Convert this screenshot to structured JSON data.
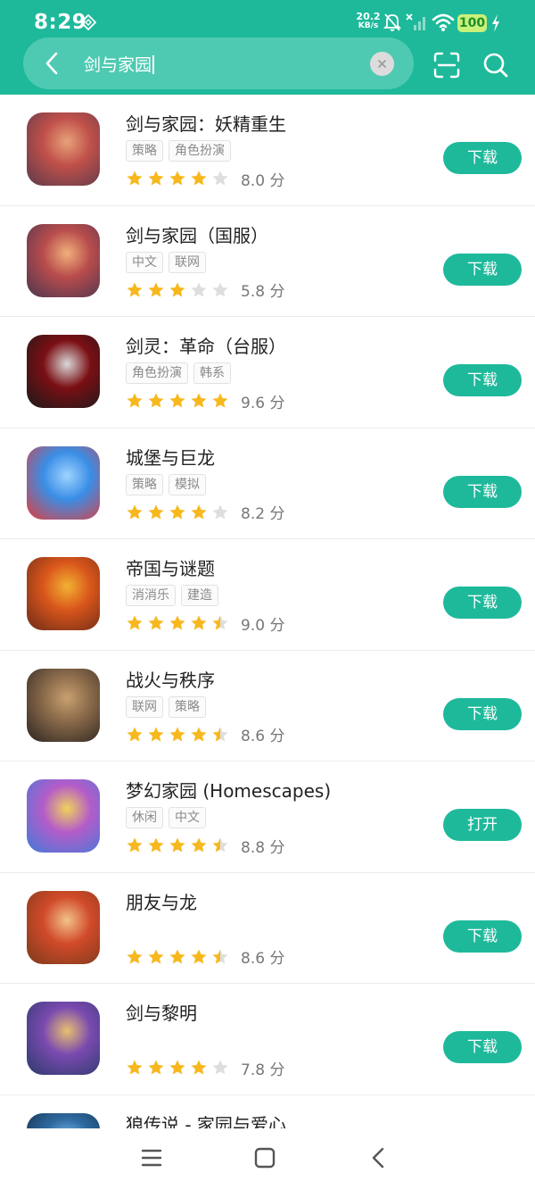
{
  "status_bar": {
    "time": "8:29",
    "net_speed_value": "20.2",
    "net_speed_unit": "KB/s",
    "battery": "100"
  },
  "search": {
    "query": "剑与家园"
  },
  "colors": {
    "accent": "#1eb99b",
    "star_filled": "#f7b81e",
    "star_empty": "#dedede"
  },
  "apps": [
    {
      "name": "剑与家园：妖精重生",
      "tags": [
        "策略",
        "角色扮演"
      ],
      "rating": 4,
      "score": "8.0 分",
      "action": "下载"
    },
    {
      "name": "剑与家园（国服）",
      "tags": [
        "中文",
        "联网"
      ],
      "rating": 3,
      "score": "5.8 分",
      "action": "下载"
    },
    {
      "name": "剑灵：革命（台服）",
      "tags": [
        "角色扮演",
        "韩系"
      ],
      "rating": 5,
      "score": "9.6 分",
      "action": "下载"
    },
    {
      "name": "城堡与巨龙",
      "tags": [
        "策略",
        "模拟"
      ],
      "rating": 4,
      "score": "8.2 分",
      "action": "下载"
    },
    {
      "name": "帝国与谜题",
      "tags": [
        "消消乐",
        "建造"
      ],
      "rating": 4.5,
      "score": "9.0 分",
      "action": "下载"
    },
    {
      "name": "战火与秩序",
      "tags": [
        "联网",
        "策略"
      ],
      "rating": 4.5,
      "score": "8.6 分",
      "action": "下载"
    },
    {
      "name": "梦幻家园 (Homescapes)",
      "tags": [
        "休闲",
        "中文"
      ],
      "rating": 4.5,
      "score": "8.8 分",
      "action": "打开"
    },
    {
      "name": "朋友与龙",
      "tags": [],
      "rating": 4.5,
      "score": "8.6 分",
      "action": "下载"
    },
    {
      "name": "剑与黎明",
      "tags": [],
      "rating": 4,
      "score": "7.8 分",
      "action": "下载"
    },
    {
      "name": "狼传说 - 家园与爱心",
      "tags": [],
      "rating": null,
      "score": null,
      "action": null
    }
  ]
}
